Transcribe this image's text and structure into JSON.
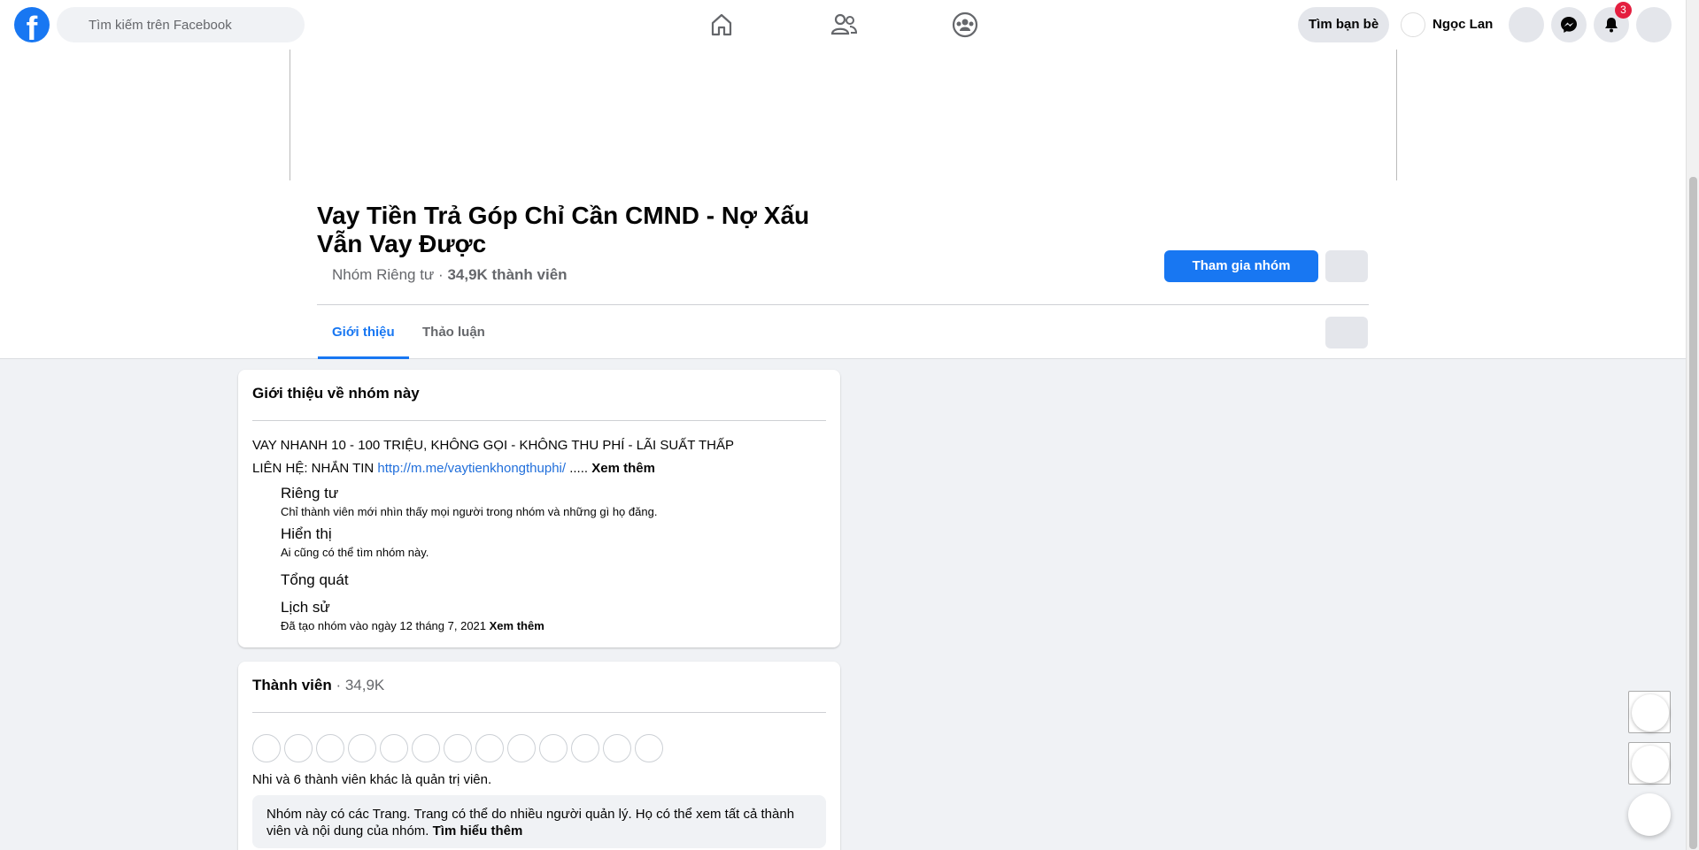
{
  "topbar": {
    "logo_letter": "f",
    "search_placeholder": "Tìm kiếm trên Facebook",
    "find_friends": "Tìm bạn bè",
    "profile_name": "Ngọc Lan",
    "notification_count": "3"
  },
  "group": {
    "title": "Vay Tiền Trả Góp Chỉ Cần CMND - Nợ Xấu Vẫn Vay Được",
    "privacy": "Nhóm Riêng tư",
    "separator": " · ",
    "members": "34,9K thành viên",
    "join_label": "Tham gia nhóm"
  },
  "tabs": [
    {
      "label": "Giới thiệu"
    },
    {
      "label": "Thảo luận"
    }
  ],
  "about": {
    "heading": "Giới thiệu về nhóm này",
    "line1": "VAY NHANH 10 - 100 TRIỆU, KHÔNG GỌI - KHÔNG THU PHÍ - LÃI SUẤT THẤP",
    "line2_prefix": "LIÊN HỆ: NHẮN TIN ",
    "line2_link": "http://m.me/vaytienkhongthuphi/",
    "line2_suffix": " ..... ",
    "see_more": "Xem thêm",
    "items": [
      {
        "title": "Riêng tư",
        "desc": "Chỉ thành viên mới nhìn thấy mọi người trong nhóm và những gì họ đăng."
      },
      {
        "title": "Hiển thị",
        "desc": "Ai cũng có thể tìm nhóm này."
      },
      {
        "title": "Tổng quát",
        "desc": ""
      },
      {
        "title": "Lịch sử",
        "desc": "Đã tạo nhóm vào ngày 12 tháng 7, 2021 "
      }
    ],
    "history_see_more": "Xem thêm"
  },
  "members_card": {
    "heading": "Thành viên",
    "count": " · 34,9K",
    "admins": "Nhi và 6 thành viên khác là quản trị viên.",
    "note": "Nhóm này có các Trang. Trang có thể do nhiều người quản lý. Họ có thể xem tất cả thành viên và nội dung của nhóm. ",
    "learn_more": "Tìm hiểu thêm"
  }
}
